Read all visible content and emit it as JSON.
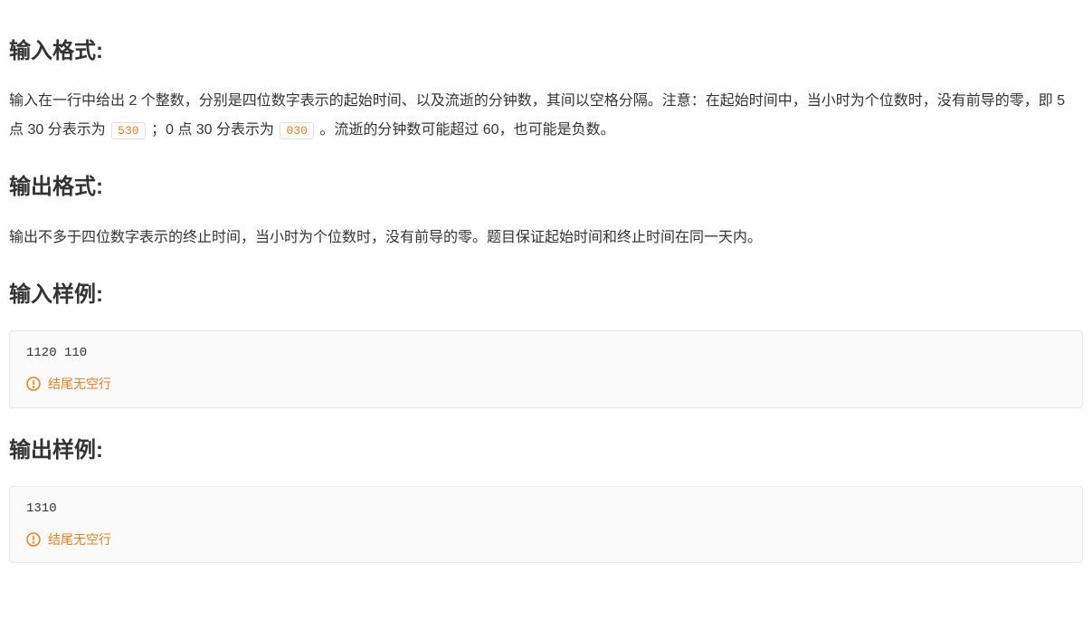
{
  "headings": {
    "input_format": "输入格式:",
    "output_format": "输出格式:",
    "input_sample": "输入样例:",
    "output_sample": "输出样例:"
  },
  "input_format_text": {
    "part1": "输入在一行中给出 2 个整数，分别是四位数字表示的起始时间、以及流逝的分钟数，其间以空格分隔。注意：在起始时间中，当小时为个位数时，没有前导的零，即 5 点 30 分表示为 ",
    "code1": "530",
    "part2": " ；0 点 30 分表示为 ",
    "code2": "030",
    "part3": " 。流逝的分钟数可能超过 60，也可能是负数。"
  },
  "output_format_text": "输出不多于四位数字表示的终止时间，当小时为个位数时，没有前导的零。题目保证起始时间和终止时间在同一天内。",
  "input_sample_code": "1120 110",
  "output_sample_code": "1310",
  "warning_text": "结尾无空行"
}
